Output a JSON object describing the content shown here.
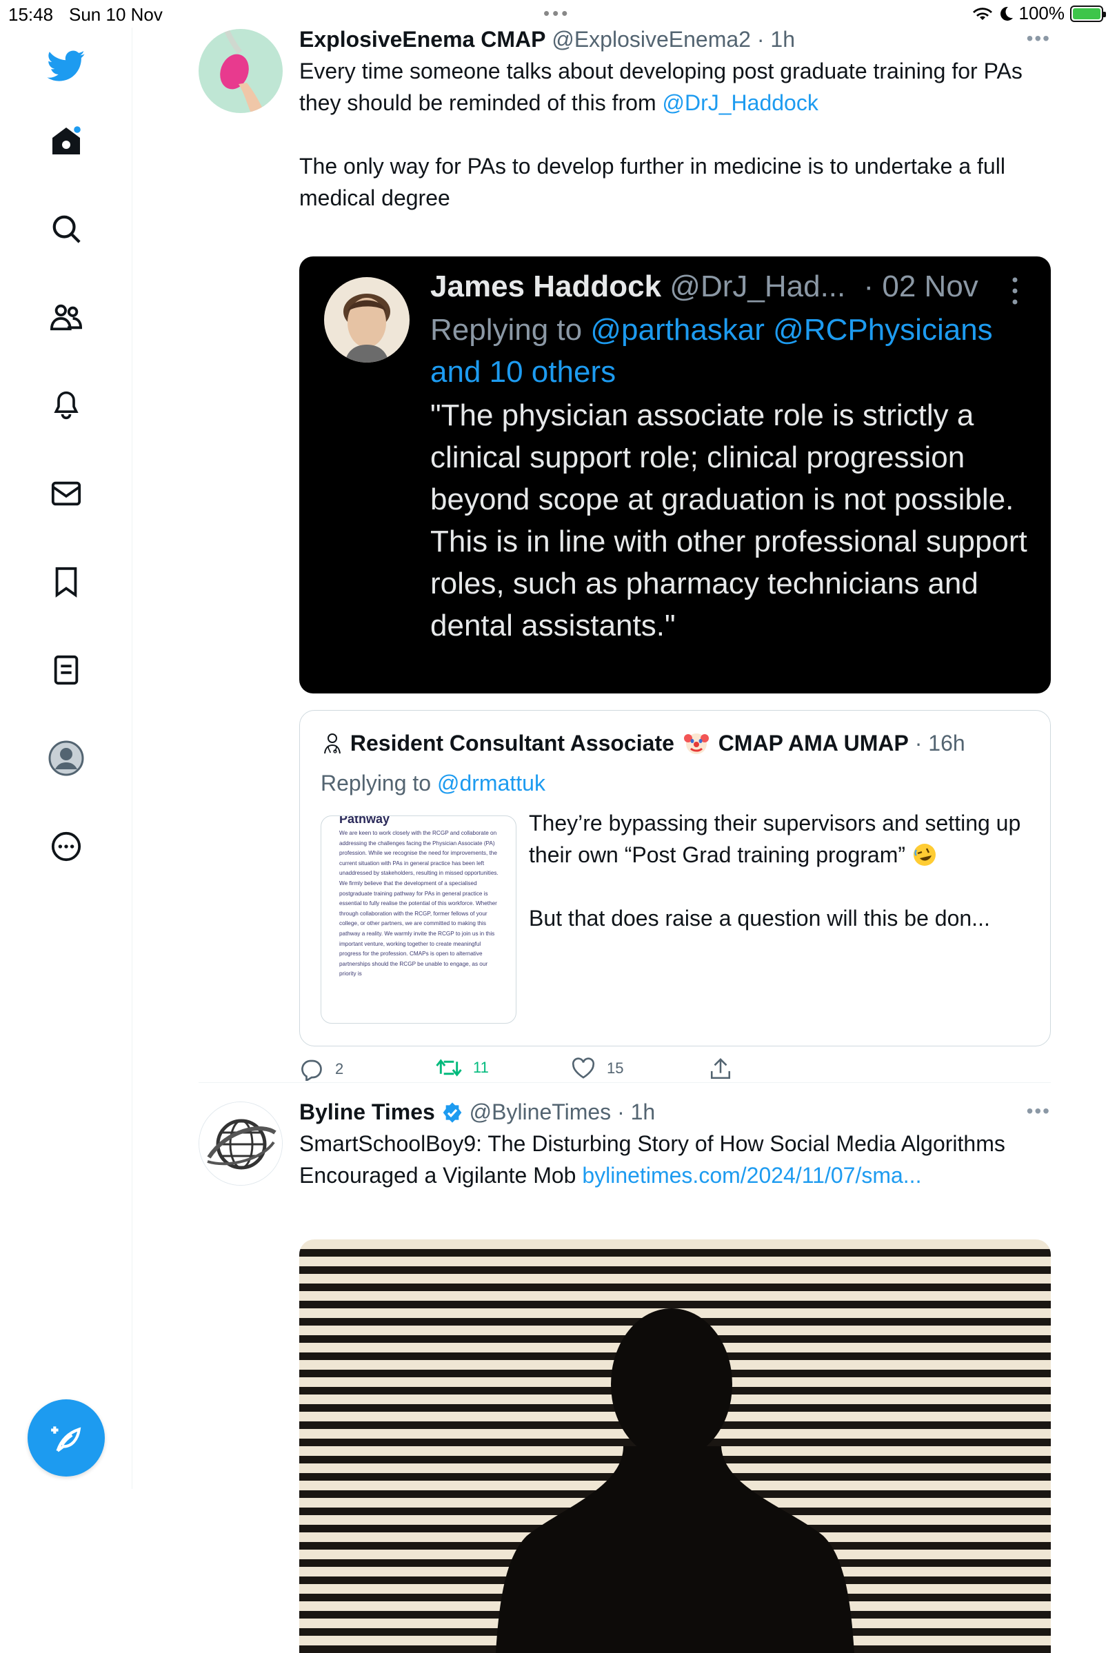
{
  "status_bar": {
    "time": "15:48",
    "date": "Sun 10 Nov",
    "battery": "100%"
  },
  "sidebar": {
    "items": [
      {
        "name": "twitter-logo"
      },
      {
        "name": "home"
      },
      {
        "name": "explore"
      },
      {
        "name": "communities"
      },
      {
        "name": "notifications"
      },
      {
        "name": "messages"
      },
      {
        "name": "bookmarks"
      },
      {
        "name": "lists"
      },
      {
        "name": "profile"
      },
      {
        "name": "more"
      }
    ],
    "accent": "#1d9bf0"
  },
  "tweet1": {
    "name": "ExplosiveEnema CMAP",
    "handle": "@ExplosiveEnema2",
    "time": "· 1h",
    "text_part1": "Every time someone talks about developing post graduate training for PAs they should be reminded of this from",
    "mention": "@DrJ_Haddock",
    "text_part2": "The only way for PAs to develop further in medicine is to undertake a full medical degree",
    "embedded_screenshot": {
      "name": "James Haddock",
      "handle": "@DrJ_Had...",
      "time": "· 02 Nov",
      "replying_label": "Replying to",
      "replying_to": "@parthaskar @RCPhysicians and 10 others",
      "text": "\"The physician associate role is strictly a clinical support role; clinical progression beyond scope at graduation is not possible. This is in line with other professional support roles, such as pharmacy technicians and dental assistants.\""
    },
    "quoted": {
      "name": "Resident Consultant Associate",
      "name_suffix": "CMAP AMA UMAP",
      "time": "· 16h",
      "replying_label": "Replying to",
      "replying_to": "@drmattuk",
      "text_line1": "They’re bypassing their supervisors and setting up their own “Post Grad training program”",
      "text_line2": "But that does raise a question will this be don...",
      "thumbnail_title": "Pathway",
      "thumbnail_text": "We are keen to work closely with the RCGP and collaborate on addressing the challenges facing the Physician Associate (PA) profession. While we recognise the need for improvements, the current situation with PAs in general practice has been left unaddressed by stakeholders, resulting in missed opportunities. We firmly believe that the development of a specialised postgraduate training pathway for PAs in general practice is essential to fully realise the potential of this workforce. Whether through collaboration with the RCGP, former fellows of your college, or other partners, we are committed to making this pathway a reality. We warmly invite the RCGP to join us in this important venture, working together to create meaningful progress for the profession. CMAPs is open to alternative partnerships should the RCGP be unable to engage, as our priority is"
    },
    "actions": {
      "replies": "2",
      "retweets": "11",
      "likes": "15"
    }
  },
  "tweet2": {
    "name": "Byline Times",
    "handle": "@BylineTimes",
    "time": "· 1h",
    "text": "SmartSchoolBoy9: The Disturbing Story of How Social Media Algorithms Encouraged a Vigilante Mob",
    "link": "bylinetimes.com/2024/11/07/sma..."
  }
}
